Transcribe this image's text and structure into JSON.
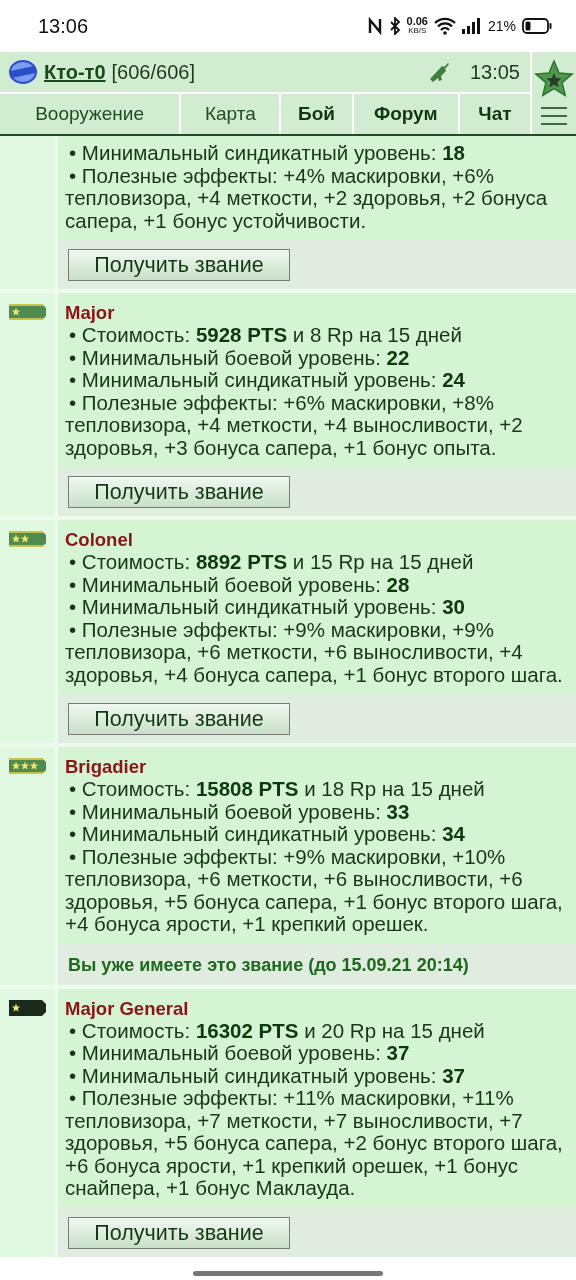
{
  "status_bar": {
    "time": "13:06",
    "speed": "0.06",
    "speed_unit": "KB/S",
    "battery": "21%"
  },
  "header": {
    "username": "Кто-т0",
    "hp": "[606/606]",
    "time": "13:05"
  },
  "tabs": [
    {
      "label": "Вооружение",
      "emphasized": false
    },
    {
      "label": "Карта",
      "emphasized": false
    },
    {
      "label": "Бой",
      "emphasized": true
    },
    {
      "label": "Форум",
      "emphasized": true
    },
    {
      "label": "Чат",
      "emphasized": true
    }
  ],
  "ranks": [
    {
      "kind": "none",
      "lines": [
        "• Минимальный синдикатный уровень: **18**",
        "• Полезные эффекты: +4% маскировки, +6% тепловизора, +4 меткости, +2 здоровья, +2 бонуса сапера, +1 бонус устойчивости."
      ],
      "footer": {
        "kind": "button",
        "text": "Получить звание"
      }
    },
    {
      "kind": "one-star",
      "title": "Major",
      "lines": [
        "• Стоимость: **5928 PTS** и 8 Rp на 15 дней",
        "• Минимальный боевой уровень: **22**",
        "• Минимальный синдикатный уровень: **24**",
        "• Полезные эффекты: +6% маскировки, +8% тепловизора, +4 меткости, +4 выносливости, +2 здоровья, +3 бонуса сапера, +1 бонус опыта."
      ],
      "footer": {
        "kind": "button",
        "text": "Получить звание"
      }
    },
    {
      "kind": "two-star",
      "title": "Colonel",
      "lines": [
        "• Стоимость: **8892 PTS** и 15 Rp на 15 дней",
        "• Минимальный боевой уровень: **28**",
        "• Минимальный синдикатный уровень: **30**",
        "• Полезные эффекты: +9% маскировки, +9% тепловизора, +6 меткости, +6 выносливости, +4 здоровья, +4 бонуса сапера, +1 бонус второго шага."
      ],
      "footer": {
        "kind": "button",
        "text": "Получить звание"
      }
    },
    {
      "kind": "three-star",
      "title": "Brigadier",
      "lines": [
        "• Стоимость: **15808 PTS** и 18 Rp на 15 дней",
        "• Минимальный боевой уровень: **33**",
        "• Минимальный синдикатный уровень: **34**",
        "• Полезные эффекты: +9% маскировки, +10% тепловизора, +6 меткости, +6 выносливости, +6 здоровья, +5 бонуса сапера, +1 бонус второго шага, +4 бонуса ярости, +1 крепкий орешек."
      ],
      "footer": {
        "kind": "owned",
        "text": "Вы уже имеете это звание (до 15.09.21 20:14)"
      }
    },
    {
      "kind": "general-star",
      "title": "Major General",
      "lines": [
        "• Стоимость: **16302 PTS** и 20 Rp на 15 дней",
        "• Минимальный боевой уровень: **37**",
        "• Минимальный синдикатный уровень: **37**",
        "• Полезные эффекты: +11% маскировки, +11% тепловизора, +7 меткости, +7 выносливости, +7 здоровья, +5 бонуса сапера, +2 бонус второго шага, +6 бонуса ярости, +1 крепкий орешек, +1 бонус снайпера, +1 бонус Маклауда."
      ],
      "footer": {
        "kind": "button",
        "text": "Получить звание"
      }
    }
  ]
}
